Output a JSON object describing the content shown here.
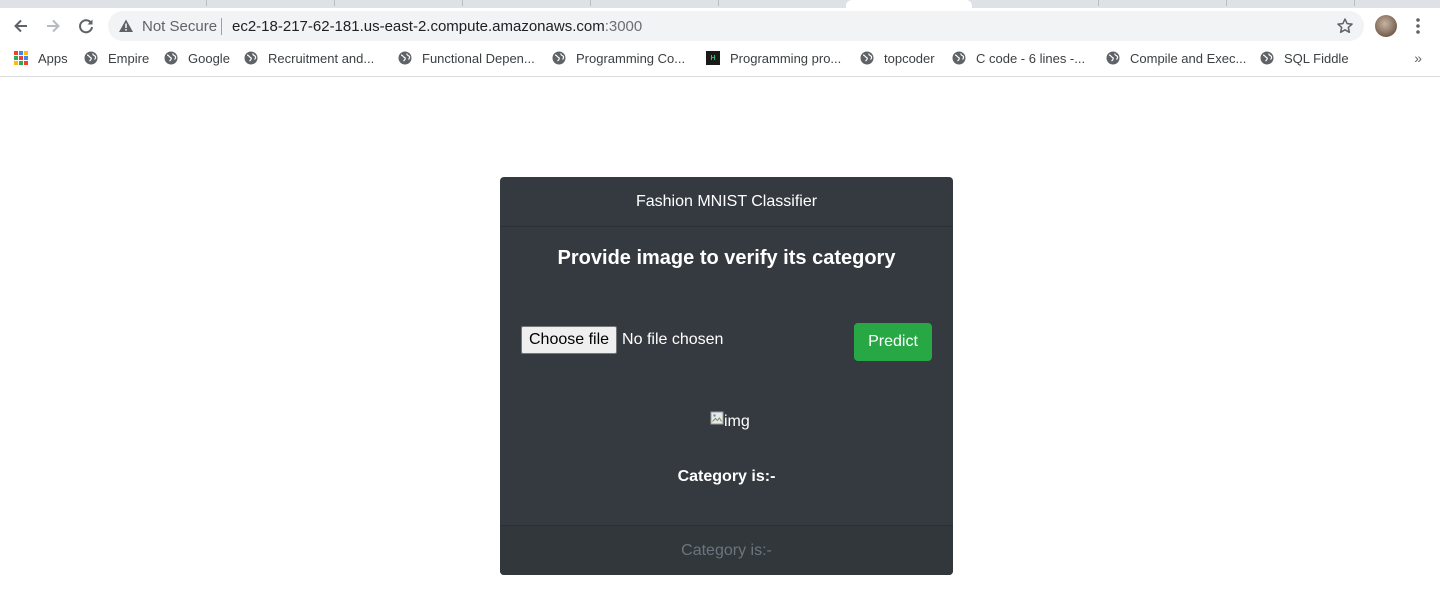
{
  "browser": {
    "security_label": "Not Secure",
    "url_host": "ec2-18-217-62-181.us-east-2.compute.amazonaws.com",
    "url_port": ":3000",
    "bookmarks": [
      {
        "label": "Apps",
        "icon": "apps-grid-icon"
      },
      {
        "label": "Empire",
        "icon": "globe-icon"
      },
      {
        "label": "Google",
        "icon": "globe-icon"
      },
      {
        "label": "Recruitment and...",
        "icon": "globe-icon"
      },
      {
        "label": "Functional Depen...",
        "icon": "globe-icon"
      },
      {
        "label": "Programming Co...",
        "icon": "globe-icon"
      },
      {
        "label": "Programming pro...",
        "icon": "hackerrank-icon"
      },
      {
        "label": "topcoder",
        "icon": "globe-icon"
      },
      {
        "label": "C code - 6 lines -...",
        "icon": "globe-icon"
      },
      {
        "label": "Compile and Exec...",
        "icon": "globe-icon"
      },
      {
        "label": "SQL Fiddle",
        "icon": "globe-icon"
      }
    ],
    "bookmarks_overflow": "»",
    "hackerrank_logo_text": "H"
  },
  "app": {
    "header": "Fashion MNIST Classifier",
    "title": "Provide image to verify its category",
    "file_button_label": "Choose file",
    "file_status": "No file chosen",
    "predict_label": "Predict",
    "image_alt": "img",
    "category_label": "Category is:-",
    "footer_label": "Category is:-"
  },
  "colors": {
    "card_bg": "#343a40",
    "predict_bg": "#28a745",
    "footer_text": "#6c757d"
  }
}
